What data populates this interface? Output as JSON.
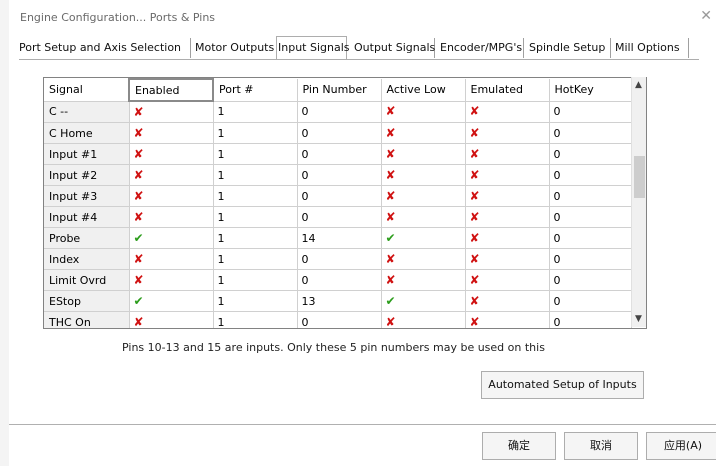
{
  "window": {
    "title": "Engine Configuration... Ports & Pins",
    "close_symbol": "✕"
  },
  "tabs": [
    {
      "label": "Port Setup and Axis Selection",
      "active": false
    },
    {
      "label": "Motor Outputs",
      "active": false
    },
    {
      "label": "Input Signals",
      "active": true
    },
    {
      "label": "Output Signals",
      "active": false
    },
    {
      "label": "Encoder/MPG's",
      "active": false
    },
    {
      "label": "Spindle Setup",
      "active": false
    },
    {
      "label": "Mill Options",
      "active": false
    }
  ],
  "grid": {
    "columns": [
      "Signal",
      "Enabled",
      "Port #",
      "Pin Number",
      "Active Low",
      "Emulated",
      "HotKey"
    ],
    "rows": [
      {
        "signal": "C --",
        "enabled": false,
        "port": "1",
        "pin": "0",
        "active_low": false,
        "emulated": false,
        "hotkey": "0"
      },
      {
        "signal": "C Home",
        "enabled": false,
        "port": "1",
        "pin": "0",
        "active_low": false,
        "emulated": false,
        "hotkey": "0"
      },
      {
        "signal": "Input #1",
        "enabled": false,
        "port": "1",
        "pin": "0",
        "active_low": false,
        "emulated": false,
        "hotkey": "0"
      },
      {
        "signal": "Input #2",
        "enabled": false,
        "port": "1",
        "pin": "0",
        "active_low": false,
        "emulated": false,
        "hotkey": "0"
      },
      {
        "signal": "Input #3",
        "enabled": false,
        "port": "1",
        "pin": "0",
        "active_low": false,
        "emulated": false,
        "hotkey": "0"
      },
      {
        "signal": "Input #4",
        "enabled": false,
        "port": "1",
        "pin": "0",
        "active_low": false,
        "emulated": false,
        "hotkey": "0"
      },
      {
        "signal": "Probe",
        "enabled": true,
        "port": "1",
        "pin": "14",
        "active_low": true,
        "emulated": false,
        "hotkey": "0"
      },
      {
        "signal": "Index",
        "enabled": false,
        "port": "1",
        "pin": "0",
        "active_low": false,
        "emulated": false,
        "hotkey": "0"
      },
      {
        "signal": "Limit Ovrd",
        "enabled": false,
        "port": "1",
        "pin": "0",
        "active_low": false,
        "emulated": false,
        "hotkey": "0"
      },
      {
        "signal": "EStop",
        "enabled": true,
        "port": "1",
        "pin": "13",
        "active_low": true,
        "emulated": false,
        "hotkey": "0"
      },
      {
        "signal": "THC On",
        "enabled": false,
        "port": "1",
        "pin": "0",
        "active_low": false,
        "emulated": false,
        "hotkey": "0"
      }
    ],
    "true_symbol": "✔",
    "false_symbol": "✘",
    "scroll_up": "▲",
    "scroll_down": "▼"
  },
  "note": "Pins 10-13 and 15 are inputs. Only these 5 pin numbers may be used on this",
  "buttons": {
    "auto_setup": "Automated Setup of Inputs",
    "ok": "确定",
    "cancel": "取消",
    "apply": "应用(A)"
  },
  "colors": {
    "x_red": "#d01212",
    "check_green": "#2c9d1c"
  }
}
